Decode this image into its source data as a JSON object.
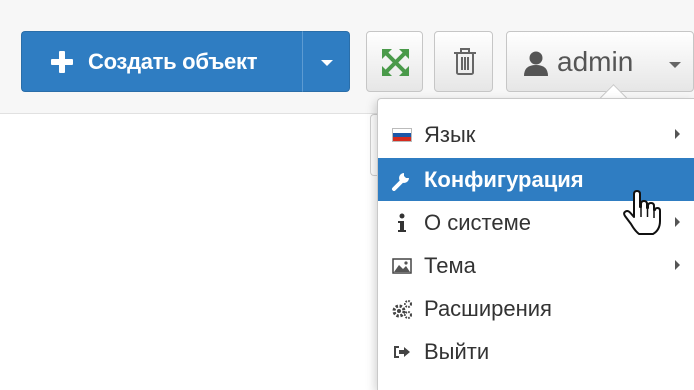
{
  "toolbar": {
    "create_button_label": "Создать объект",
    "user_button_label": "admin"
  },
  "icons": {
    "create": "plus-icon",
    "expand": "expand-arrows-icon",
    "trash": "trash-icon",
    "user": "user-icon",
    "menu_language": "russian-flag-icon",
    "menu_config": "wrench-icon",
    "menu_about": "info-icon",
    "menu_theme": "picture-icon",
    "menu_extensions": "gears-icon",
    "menu_logout": "sign-out-icon"
  },
  "colors": {
    "primary": "#2f7dc2",
    "menu_active": "#2f7dc2",
    "expand_icon": "#4a9a4a"
  },
  "user_menu": {
    "items": [
      {
        "label": "Язык",
        "has_submenu": true,
        "active": false
      },
      {
        "label": "Конфигурация",
        "has_submenu": false,
        "active": true
      },
      {
        "label": "О системе",
        "has_submenu": true,
        "active": false
      },
      {
        "label": "Тема",
        "has_submenu": true,
        "active": false
      },
      {
        "label": "Расширения",
        "has_submenu": false,
        "active": false
      },
      {
        "label": "Выйти",
        "has_submenu": false,
        "active": false
      }
    ]
  }
}
